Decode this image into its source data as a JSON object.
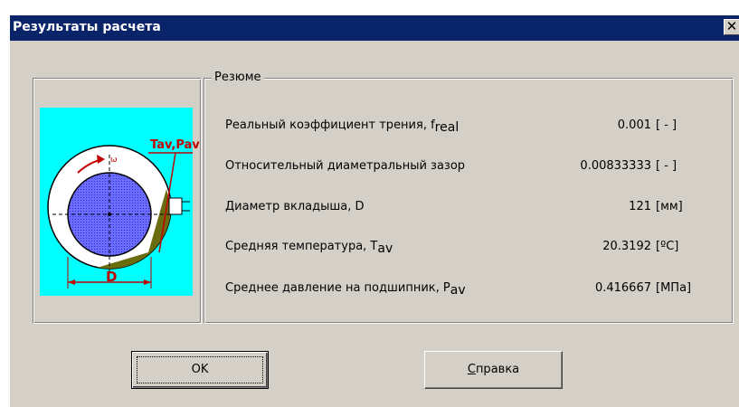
{
  "window": {
    "title": "Результаты расчета",
    "close_glyph": "✕"
  },
  "picture": {
    "icon": "bearing-diagram",
    "labels": {
      "temp_pressure": "Tav,Pav",
      "diameter": "D"
    },
    "colors": {
      "background": "#00ffff",
      "shaft": "#6c6cff",
      "oil_film": "#6b6b10",
      "label": "#c00000"
    }
  },
  "summary": {
    "legend": "Резюме",
    "rows": [
      {
        "label": "Реальный коэффициент трения, f",
        "sub": "real",
        "value": "0.001",
        "unit": "[ - ]"
      },
      {
        "label": "Относительный диаметральный зазор",
        "sub": "",
        "value": "0.00833333",
        "unit": "[ - ]"
      },
      {
        "label": "Диаметр вкладыша, D",
        "sub": "",
        "value": "121",
        "unit": "[мм]"
      },
      {
        "label": "Средняя температура,   T",
        "sub": "av",
        "value": "20.3192",
        "unit": "[ºC]"
      },
      {
        "label": "Среднее давление на подшипник,  P",
        "sub": "av",
        "value": "0.416667",
        "unit": "[МПа]"
      }
    ]
  },
  "buttons": {
    "ok": "OK",
    "help_mnemonic": "С",
    "help_rest": "правка"
  }
}
